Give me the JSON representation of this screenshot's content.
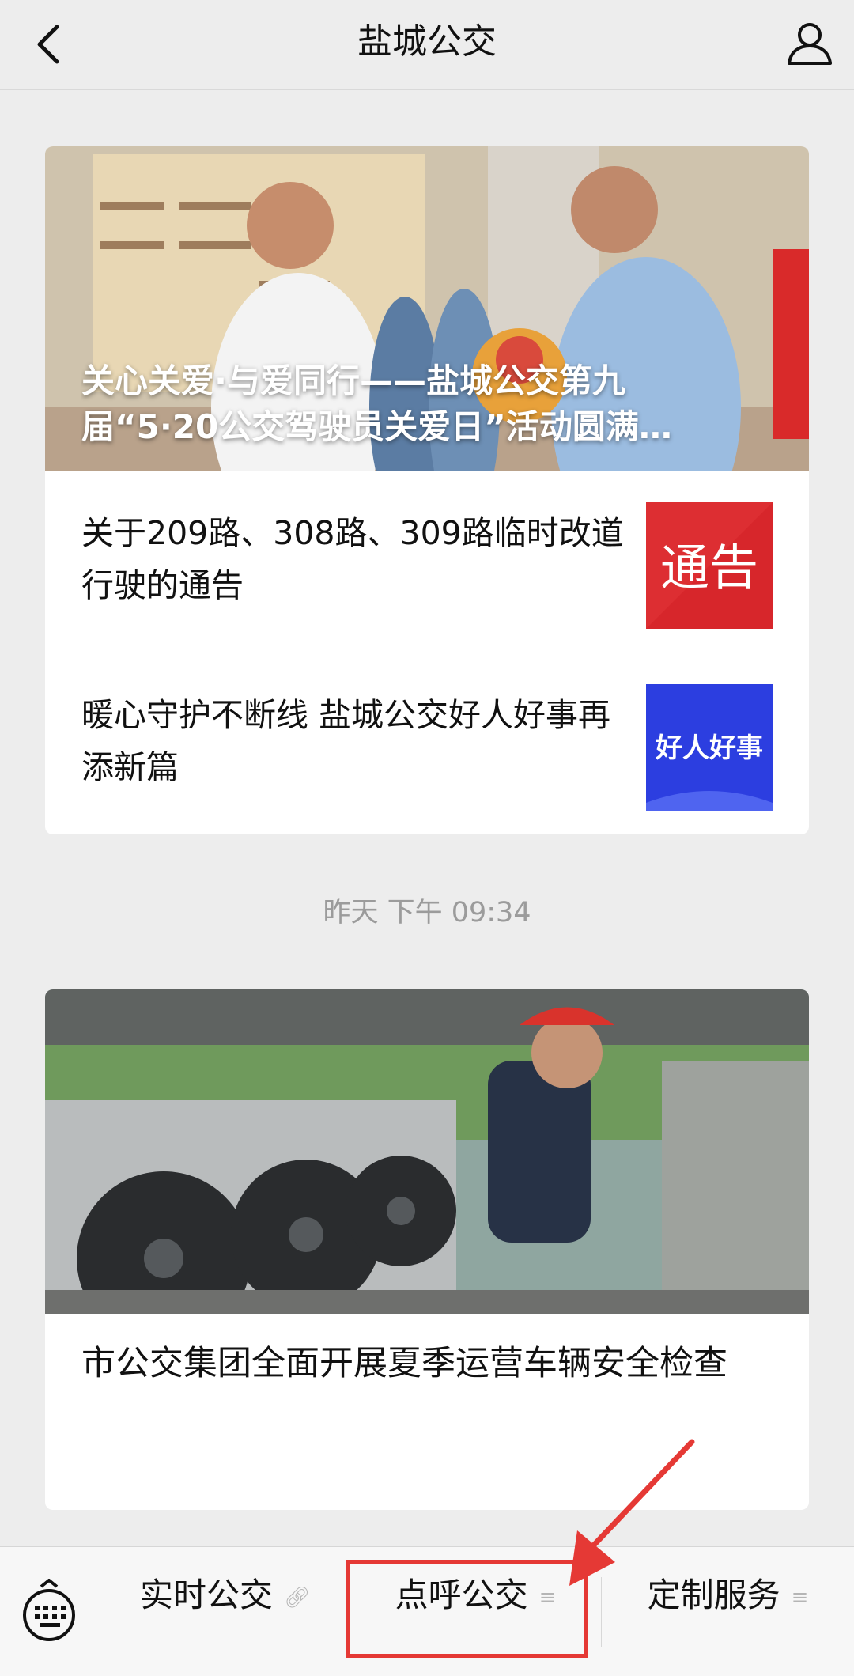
{
  "header": {
    "title": "盐城公交",
    "back_icon": "chevron-left-icon",
    "user_icon": "user-icon"
  },
  "feed": {
    "group1": {
      "hero_title": "关心关爱·与爱同行——盐城公交第九届“5·20公交驾驶员关爱日”活动圆满…",
      "items": [
        {
          "title": "关于209路、308路、309路临时改道行驶的通告",
          "thumb_text": "通告",
          "thumb_color": "#d7262b"
        },
        {
          "title": "暖心守护不断线 盐城公交好人好事再添新篇",
          "thumb_text": "好人好事",
          "thumb_color": "#2c3ee0"
        }
      ]
    },
    "timestamp": "昨天 下午 09:34",
    "group2": {
      "title": "市公交集团全面开展夏季运营车辆安全检查"
    }
  },
  "menu": {
    "keyboard_icon": "keyboard-icon",
    "items": [
      {
        "label": "实时公交",
        "icon": "link-icon",
        "icon_glyph": "🔗︎"
      },
      {
        "label": "点呼公交",
        "icon": "menu-lines-icon",
        "icon_glyph": "≡"
      },
      {
        "label": "定制服务",
        "icon": "menu-lines-icon",
        "icon_glyph": "≡"
      }
    ]
  },
  "colors": {
    "highlight": "#e53935",
    "background": "#ededed"
  }
}
